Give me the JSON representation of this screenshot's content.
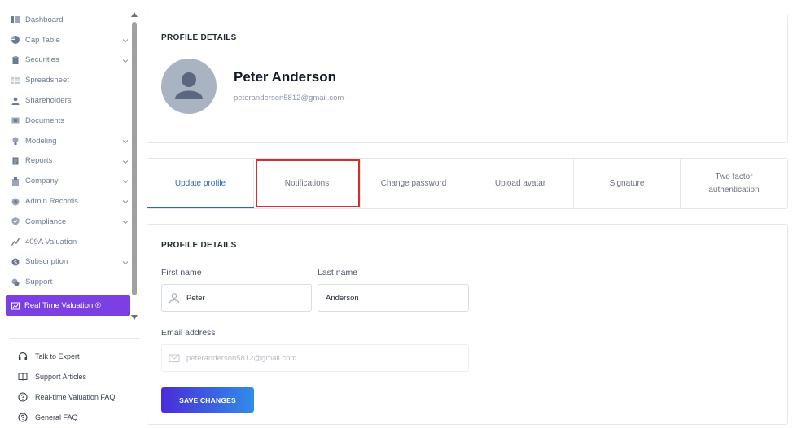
{
  "sidebar": {
    "items": [
      {
        "label": "Dashboard",
        "icon": "dashboard-icon",
        "chevron": false
      },
      {
        "label": "Cap Table",
        "icon": "pie-chart-icon",
        "chevron": true
      },
      {
        "label": "Securities",
        "icon": "clipboard-icon",
        "chevron": true
      },
      {
        "label": "Spreadsheet",
        "icon": "spreadsheet-icon",
        "chevron": false
      },
      {
        "label": "Shareholders",
        "icon": "user-icon",
        "chevron": false
      },
      {
        "label": "Documents",
        "icon": "document-icon",
        "chevron": false
      },
      {
        "label": "Modeling",
        "icon": "lightbulb-icon",
        "chevron": true
      },
      {
        "label": "Reports",
        "icon": "report-icon",
        "chevron": true
      },
      {
        "label": "Company",
        "icon": "building-icon",
        "chevron": true
      },
      {
        "label": "Admin Records",
        "icon": "admin-records-icon",
        "chevron": true
      },
      {
        "label": "Compliance",
        "icon": "shield-check-icon",
        "chevron": true
      },
      {
        "label": "409A Valuation",
        "icon": "valuation-chart-icon",
        "chevron": false
      },
      {
        "label": "Subscription",
        "icon": "dollar-circle-icon",
        "chevron": true
      },
      {
        "label": "Support",
        "icon": "support-chat-icon",
        "chevron": false
      }
    ],
    "highlight_item": {
      "label": "Real Time Valuation ®",
      "icon": "realtime-icon"
    },
    "help_items": [
      {
        "label": "Talk to Expert",
        "icon": "headphones-icon"
      },
      {
        "label": "Support Articles",
        "icon": "book-open-icon"
      },
      {
        "label": "Real-time Valuation FAQ",
        "icon": "question-circle-icon"
      },
      {
        "label": "General FAQ",
        "icon": "question-circle-icon"
      }
    ]
  },
  "profile": {
    "section_title": "PROFILE DETAILS",
    "name": "Peter Anderson",
    "email": "peteranderson5812@gmail.com"
  },
  "tabs": [
    {
      "label": "Update profile",
      "active": true
    },
    {
      "label": "Notifications",
      "active": false
    },
    {
      "label": "Change password",
      "active": false
    },
    {
      "label": "Upload avatar",
      "active": false
    },
    {
      "label": "Signature",
      "active": false
    },
    {
      "label": "Two factor\nauthentication",
      "active": false
    }
  ],
  "form": {
    "section_title": "PROFILE DETAILS",
    "first_name_label": "First name",
    "first_name_value": "Peter",
    "last_name_label": "Last name",
    "last_name_value": "Anderson",
    "email_label": "Email address",
    "email_value": "peteranderson5812@gmail.com",
    "save_label": "SAVE CHANGES"
  },
  "colors": {
    "accent": "#2b6cb0",
    "highlight_purple": "#7b3fe4",
    "annotation_red": "#d32f2f"
  }
}
